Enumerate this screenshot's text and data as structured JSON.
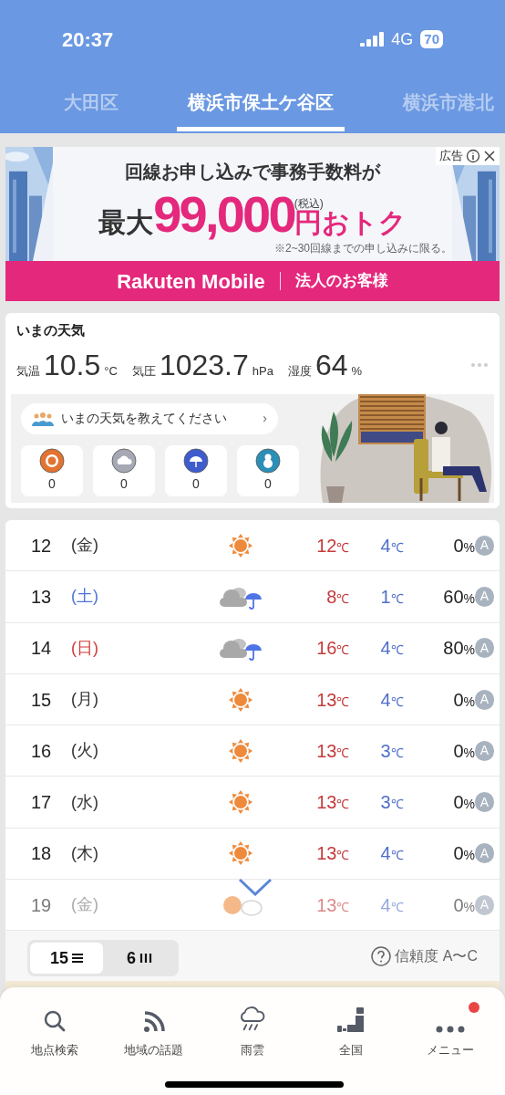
{
  "status_bar": {
    "time": "20:37",
    "network": "4G",
    "battery": "70"
  },
  "tabs": [
    {
      "label": "大田区",
      "selected": false
    },
    {
      "label": "横浜市保土ケ谷区",
      "selected": true
    },
    {
      "label": "横浜市港北",
      "selected": false
    }
  ],
  "ad": {
    "label": "広告",
    "headline": "回線お申し込みで事務手数料が",
    "prefix": "最大",
    "amount": "99,000",
    "tax": "(税込)",
    "suffix": "円おトク",
    "note": "※2~30回線までの申し込みに限る。",
    "brand": "Rakuten Mobile",
    "audience": "法人のお客様"
  },
  "current_weather": {
    "title": "いまの天気",
    "readings": [
      {
        "label": "気温",
        "value": "10.5",
        "unit": "°C"
      },
      {
        "label": "気圧",
        "value": "1023.7",
        "unit": "hPa"
      },
      {
        "label": "湿度",
        "value": "64",
        "unit": "%"
      }
    ],
    "report_prompt": "いまの天気を教えてください",
    "report_arrow": "›",
    "reports": [
      {
        "kind": "sunny",
        "count": "0"
      },
      {
        "kind": "cloudy",
        "count": "0"
      },
      {
        "kind": "rain",
        "count": "0"
      },
      {
        "kind": "snow",
        "count": "0"
      }
    ]
  },
  "forecast": [
    {
      "date": "12",
      "weekday": "(金)",
      "color": "#333333",
      "kind": "sunny",
      "high": "12",
      "high_unit": "℃",
      "low": "4",
      "low_unit": "℃",
      "precip": "0",
      "precip_unit": "%",
      "reliability": "A",
      "faded": false
    },
    {
      "date": "13",
      "weekday": "(土)",
      "color": "#4f74d8",
      "kind": "cloudy_rain",
      "high": "8",
      "high_unit": "℃",
      "low": "1",
      "low_unit": "℃",
      "precip": "60",
      "precip_unit": "%",
      "reliability": "A",
      "faded": false
    },
    {
      "date": "14",
      "weekday": "(日)",
      "color": "#d23a3a",
      "kind": "cloudy_rain",
      "high": "16",
      "high_unit": "℃",
      "low": "4",
      "low_unit": "℃",
      "precip": "80",
      "precip_unit": "%",
      "reliability": "A",
      "faded": false
    },
    {
      "date": "15",
      "weekday": "(月)",
      "color": "#333333",
      "kind": "sunny",
      "high": "13",
      "high_unit": "℃",
      "low": "4",
      "low_unit": "℃",
      "precip": "0",
      "precip_unit": "%",
      "reliability": "A",
      "faded": false
    },
    {
      "date": "16",
      "weekday": "(火)",
      "color": "#333333",
      "kind": "sunny",
      "high": "13",
      "high_unit": "℃",
      "low": "3",
      "low_unit": "℃",
      "precip": "0",
      "precip_unit": "%",
      "reliability": "A",
      "faded": false
    },
    {
      "date": "17",
      "weekday": "(水)",
      "color": "#333333",
      "kind": "sunny",
      "high": "13",
      "high_unit": "℃",
      "low": "3",
      "low_unit": "℃",
      "precip": "0",
      "precip_unit": "%",
      "reliability": "A",
      "faded": false
    },
    {
      "date": "18",
      "weekday": "(木)",
      "color": "#333333",
      "kind": "sunny",
      "high": "13",
      "high_unit": "℃",
      "low": "4",
      "low_unit": "℃",
      "precip": "0",
      "precip_unit": "%",
      "reliability": "A",
      "faded": false
    },
    {
      "date": "19",
      "weekday": "(金)",
      "color": "#aaaaaa",
      "kind": "sunny_cloudy",
      "high": "13",
      "high_unit": "℃",
      "low": "4",
      "low_unit": "℃",
      "precip": "0",
      "precip_unit": "%",
      "reliability": "A",
      "faded": true
    }
  ],
  "view_toggle": [
    {
      "label": "15",
      "kind": "list",
      "selected": true
    },
    {
      "label": "6",
      "kind": "columns",
      "selected": false
    }
  ],
  "reliability_help": "信頼度 A〜C",
  "nav": [
    {
      "label": "地点検索",
      "kind": "search",
      "badge": false
    },
    {
      "label": "地域の話題",
      "kind": "feed",
      "badge": false
    },
    {
      "label": "雨雲",
      "kind": "rain",
      "badge": false
    },
    {
      "label": "全国",
      "kind": "map",
      "badge": false
    },
    {
      "label": "メニュー",
      "kind": "more",
      "badge": true
    }
  ]
}
